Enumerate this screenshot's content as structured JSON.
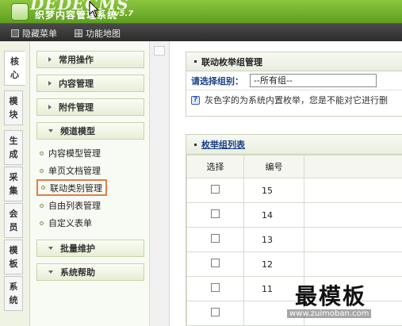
{
  "header": {
    "brand": "DEDECMS",
    "subtitle": "织梦内容管理系统",
    "version": "v5.7"
  },
  "toolbar": {
    "hide_menu": "隐藏菜单",
    "function_map": "功能地图"
  },
  "vtabs": [
    {
      "label": "核心",
      "active": true
    },
    {
      "label": "模块",
      "active": false
    },
    {
      "label": "生成",
      "active": false
    },
    {
      "label": "采集",
      "active": false
    },
    {
      "label": "会员",
      "active": false
    },
    {
      "label": "模板",
      "active": false
    },
    {
      "label": "系统",
      "active": false
    }
  ],
  "sidebar": {
    "sections": [
      {
        "label": "常用操作",
        "expanded": false
      },
      {
        "label": "内容管理",
        "expanded": false
      },
      {
        "label": "附件管理",
        "expanded": false
      },
      {
        "label": "频道模型",
        "expanded": true
      },
      {
        "label": "批量维护",
        "expanded": false
      },
      {
        "label": "系统帮助",
        "expanded": false
      }
    ],
    "items": [
      {
        "label": "内容模型管理"
      },
      {
        "label": "单页文档管理"
      },
      {
        "label": "联动类别管理",
        "highlighted": true
      },
      {
        "label": "自由列表管理"
      },
      {
        "label": "自定义表单"
      }
    ]
  },
  "main": {
    "panel_title": "联动枚举组管理",
    "filter_label": "请选择组别：",
    "filter_value": "--所有组--",
    "help_text": "灰色字的为系统内置枚举，您是不能对它进行删",
    "list_title": "枚举组列表",
    "columns": [
      "选择",
      "编号"
    ],
    "rows": [
      {
        "id": "15"
      },
      {
        "id": "14"
      },
      {
        "id": "13"
      },
      {
        "id": "12"
      },
      {
        "id": "11"
      },
      {
        "id": ""
      }
    ],
    "edge_char": "系"
  },
  "watermark": {
    "text": "最模板",
    "url": "www.zuimoban.com"
  }
}
